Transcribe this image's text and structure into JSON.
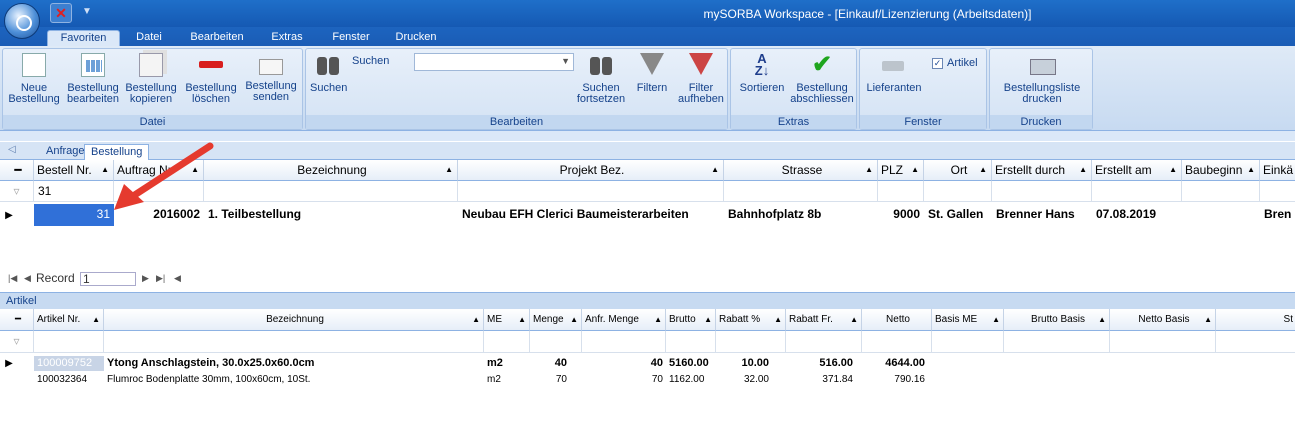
{
  "window": {
    "title": "mySORBA Workspace - [Einkauf/Lizenzierung (Arbeitsdaten)]"
  },
  "ribbon_tabs": [
    "Favoriten",
    "Datei",
    "Bearbeiten",
    "Extras",
    "Fenster",
    "Drucken"
  ],
  "groups": {
    "datei": {
      "label": "Datei",
      "buttons": [
        {
          "l1": "Neue",
          "l2": "Bestellung",
          "icon": "new-document-icon"
        },
        {
          "l1": "Bestellung",
          "l2": "bearbeiten",
          "icon": "edit-table-icon"
        },
        {
          "l1": "Bestellung",
          "l2": "kopieren",
          "icon": "copy-icon"
        },
        {
          "l1": "Bestellung",
          "l2": "löschen",
          "icon": "delete-icon"
        },
        {
          "l1": "Bestellung",
          "l2": "senden",
          "icon": "mail-icon"
        }
      ]
    },
    "bearbeiten": {
      "label": "Bearbeiten",
      "search_label": "Suchen",
      "search_value": "",
      "buttons": [
        {
          "l1": "Suchen",
          "l2": "",
          "icon": "binoculars-icon"
        },
        {
          "l1": "Suchen",
          "l2": "fortsetzen",
          "icon": "binoculars-plus-icon"
        },
        {
          "l1": "Filtern",
          "l2": "",
          "icon": "funnel-icon"
        },
        {
          "l1": "Filter",
          "l2": "aufheben",
          "icon": "funnel-remove-icon"
        }
      ]
    },
    "extras": {
      "label": "Extras",
      "buttons": [
        {
          "l1": "Sortieren",
          "l2": "",
          "icon": "sort-az-icon"
        },
        {
          "l1": "Bestellung",
          "l2": "abschliessen",
          "icon": "checkmark-icon"
        }
      ]
    },
    "fenster": {
      "label": "Fenster",
      "checkbox_label": "Artikel",
      "buttons": [
        {
          "l1": "Lieferanten",
          "l2": "",
          "icon": "truck-icon"
        }
      ]
    },
    "drucken": {
      "label": "Drucken",
      "buttons": [
        {
          "l1": "Bestellungsliste",
          "l2": "drucken",
          "icon": "printer-icon"
        }
      ]
    }
  },
  "subtabs": [
    "Anfrage",
    "Bestellung"
  ],
  "orders": {
    "columns": [
      "Bestell Nr.",
      "Auftrag Nr.",
      "Bezeichnung",
      "Projekt Bez.",
      "Strasse",
      "PLZ",
      "Ort",
      "Erstellt durch",
      "Erstellt am",
      "Baubeginn",
      "Einkä"
    ],
    "filter": "31",
    "row": {
      "bestell_nr": "31",
      "auftrag": "2016002",
      "bez": "1. Teilbestellung",
      "projekt": "Neubau EFH Clerici Baumeisterarbeiten",
      "strasse": "Bahnhofplatz 8b",
      "plz": "9000",
      "ort": "St. Gallen",
      "erstellt_durch": "Brenner Hans",
      "erstellt_am": "07.08.2019",
      "baubeginn": "",
      "einkauf": "Bren"
    },
    "nav": {
      "label": "Record",
      "value": "1"
    }
  },
  "artikel": {
    "title": "Artikel",
    "columns": [
      "Artikel Nr.",
      "Bezeichnung",
      "ME",
      "Menge",
      "Anfr. Menge",
      "Brutto",
      "Rabatt %",
      "Rabatt Fr.",
      "Netto",
      "Basis ME",
      "Brutto Basis",
      "Netto Basis",
      "St"
    ],
    "rows": [
      {
        "nr": "100009752",
        "bez": "Ytong Anschlagstein, 30.0x25.0x60.0cm",
        "me": "m2",
        "menge": "40",
        "anfr": "40",
        "brutto": "5160.00",
        "rabatt_p": "10.00",
        "rabatt_fr": "516.00",
        "netto": "4644.00"
      },
      {
        "nr": "100032364",
        "bez": "Flumroc Bodenplatte 30mm, 100x60cm, 10St.",
        "me": "m2",
        "menge": "70",
        "anfr": "70",
        "brutto": "1162.00",
        "rabatt_p": "32.00",
        "rabatt_fr": "371.84",
        "netto": "790.16"
      }
    ]
  },
  "colors": {
    "accent": "#1a5cb5",
    "selection": "#3070d8",
    "arrow": "#e53a2e"
  }
}
